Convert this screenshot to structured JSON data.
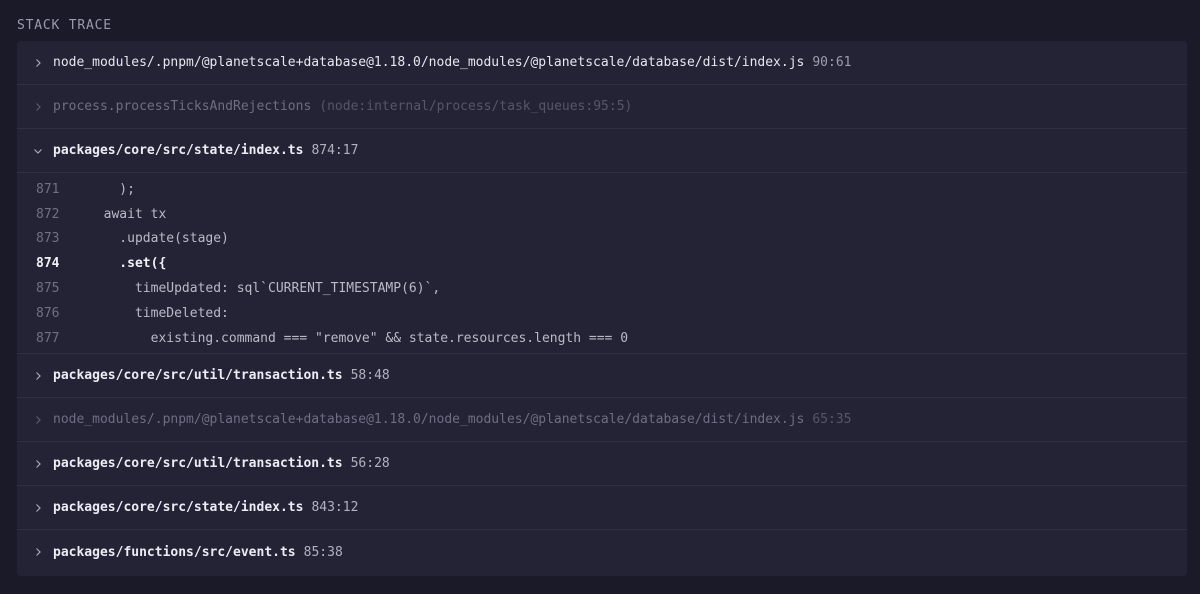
{
  "section_title": "STACK TRACE",
  "frames": [
    {
      "path": "node_modules/.pnpm/@planetscale+database@1.18.0/node_modules/@planetscale/database/dist/index.js",
      "loc": "90:61",
      "style": "normal",
      "expanded": false
    },
    {
      "path": "process.processTicksAndRejections",
      "loc": "(node:internal/process/task_queues:95:5)",
      "style": "dim",
      "expanded": false
    },
    {
      "path": "packages/core/src/state/index.ts",
      "loc": "874:17",
      "style": "bright",
      "expanded": true
    },
    {
      "path": "packages/core/src/util/transaction.ts",
      "loc": "58:48",
      "style": "bright",
      "expanded": false
    },
    {
      "path": "node_modules/.pnpm/@planetscale+database@1.18.0/node_modules/@planetscale/database/dist/index.js",
      "loc": "65:35",
      "style": "dim",
      "expanded": false
    },
    {
      "path": "packages/core/src/util/transaction.ts",
      "loc": "56:28",
      "style": "bright",
      "expanded": false
    },
    {
      "path": "packages/core/src/state/index.ts",
      "loc": "843:12",
      "style": "bright",
      "expanded": false
    },
    {
      "path": "packages/functions/src/event.ts",
      "loc": "85:38",
      "style": "bright",
      "expanded": false
    }
  ],
  "code": {
    "active_line": "874",
    "lines": [
      {
        "num": "871",
        "text": "    );"
      },
      {
        "num": "872",
        "text": "  await tx"
      },
      {
        "num": "873",
        "text": "    .update(stage)"
      },
      {
        "num": "874",
        "text": "    .set({"
      },
      {
        "num": "875",
        "text": "      timeUpdated: sql`CURRENT_TIMESTAMP(6)`,"
      },
      {
        "num": "876",
        "text": "      timeDeleted:"
      },
      {
        "num": "877",
        "text": "        existing.command === \"remove\" && state.resources.length === 0"
      }
    ]
  },
  "icons": {
    "collapsed": "chevron-right-icon",
    "expanded": "chevron-down-icon"
  }
}
